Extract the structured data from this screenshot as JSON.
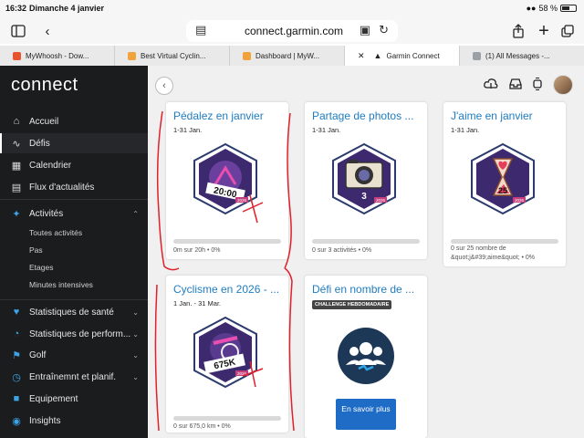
{
  "status": {
    "time": "16:32",
    "date": "Dimanche 4 janvier",
    "battery": "58 %"
  },
  "browser": {
    "url": "connect.garmin.com"
  },
  "tabs": [
    {
      "label": "MyWhoosh - Dow...",
      "color": "#e8542d",
      "active": false
    },
    {
      "label": "Best Virtual Cyclin...",
      "color": "#f2a23a",
      "active": false
    },
    {
      "label": "Dashboard | MyW...",
      "color": "#f2a23a",
      "active": false
    },
    {
      "label": "Garmin Connect",
      "color": "#222222",
      "active": true
    },
    {
      "label": "(1) All Messages -...",
      "color": "#9aa0a6",
      "active": false
    }
  ],
  "sidebar": {
    "logo": "connect",
    "items": [
      {
        "label": "Accueil",
        "icon": "home-icon"
      },
      {
        "label": "Défis",
        "icon": "wave-icon"
      },
      {
        "label": "Calendrier",
        "icon": "calendar-icon"
      },
      {
        "label": "Flux d'actualités",
        "icon": "news-icon"
      },
      {
        "label": "Activités",
        "icon": "runner-icon"
      },
      {
        "label": "Statistiques de santé",
        "icon": "heart-icon"
      },
      {
        "label": "Statistiques de perform...",
        "icon": "gauge-icon"
      },
      {
        "label": "Golf",
        "icon": "golf-icon"
      },
      {
        "label": "Entraînemnt et planif.",
        "icon": "stopwatch-icon"
      },
      {
        "label": "Equipement",
        "icon": "shoe-icon"
      },
      {
        "label": "Insights",
        "icon": "bulb-icon"
      }
    ],
    "sub_items": [
      "Toutes activités",
      "Pas",
      "Etages",
      "Minutes intensives"
    ]
  },
  "cards": [
    {
      "title": "Pédalez en janvier",
      "dates": "1-31 Jan.",
      "progress": "0m sur 20h • 0%",
      "badge_text": "20:00",
      "badge_year": "2026",
      "badge_color": "#c43d7c"
    },
    {
      "title": "Partage de photos ...",
      "dates": "1-31 Jan.",
      "progress": "0 sur 3 activités • 0%",
      "badge_text": "3",
      "badge_year": "2026",
      "badge_color": "#c43d7c"
    },
    {
      "title": "J'aime en janvier",
      "dates": "1-31 Jan.",
      "progress": "0 sur 25 nombre de &quot;j&#39;aime&quot; • 0%",
      "badge_text": "25",
      "badge_year": "2026",
      "badge_color": "#c43d7c"
    },
    {
      "title": "Cyclisme en 2026 - ...",
      "dates": "1 Jan. - 31 Mar.",
      "progress": "0 sur 675,0 km • 0%",
      "badge_text": "675K",
      "badge_year": "2026",
      "badge_color": "#c43d7c"
    },
    {
      "title": "Défi en nombre de ...",
      "tag": "CHALLENGE HEBDOMADAIRE",
      "button": "En savoir plus"
    }
  ]
}
